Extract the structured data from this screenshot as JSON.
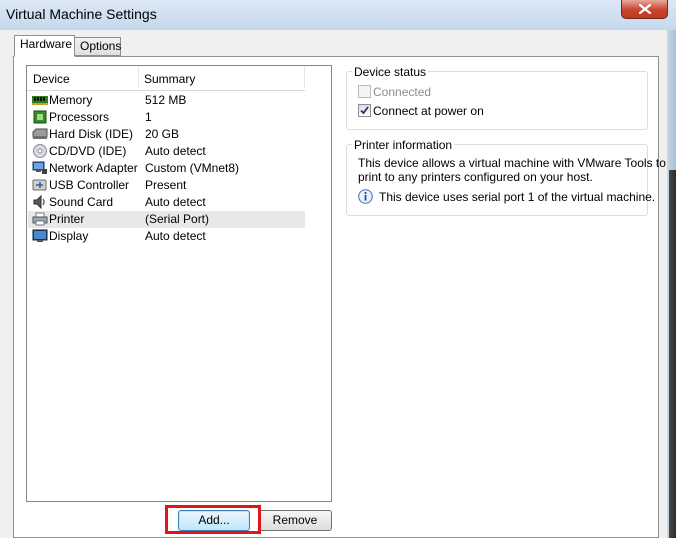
{
  "window": {
    "title": "Virtual Machine Settings"
  },
  "tabs": [
    {
      "label": "Hardware",
      "active": true
    },
    {
      "label": "Options",
      "active": false
    }
  ],
  "device_list": {
    "columns": {
      "device": "Device",
      "summary": "Summary"
    },
    "rows": [
      {
        "device": "Memory",
        "summary": "512 MB",
        "icon": "memory-icon"
      },
      {
        "device": "Processors",
        "summary": "1",
        "icon": "processor-icon"
      },
      {
        "device": "Hard Disk (IDE)",
        "summary": "20 GB",
        "icon": "hard-disk-icon"
      },
      {
        "device": "CD/DVD (IDE)",
        "summary": "Auto detect",
        "icon": "cd-dvd-icon"
      },
      {
        "device": "Network Adapter",
        "summary": "Custom (VMnet8)",
        "icon": "network-adapter-icon"
      },
      {
        "device": "USB Controller",
        "summary": "Present",
        "icon": "usb-icon"
      },
      {
        "device": "Sound Card",
        "summary": "Auto detect",
        "icon": "speaker-icon"
      },
      {
        "device": "Printer",
        "summary": "(Serial Port)",
        "icon": "printer-icon",
        "selected": true
      },
      {
        "device": "Display",
        "summary": "Auto detect",
        "icon": "display-icon"
      }
    ]
  },
  "buttons": {
    "add": "Add...",
    "remove": "Remove"
  },
  "device_status": {
    "title": "Device status",
    "connected": {
      "label": "Connected",
      "checked": false,
      "disabled": true
    },
    "connect_at_power_on": {
      "label": "Connect at power on",
      "checked": true
    }
  },
  "printer_info": {
    "title": "Printer information",
    "line1": "This device allows a virtual machine with VMware Tools to",
    "line2": "print to any printers configured on your host.",
    "note": "This device uses serial port 1 of the virtual machine.",
    "note_icon": "info-icon"
  },
  "colors": {
    "highlight": "#e0151e",
    "close_button": "#c8442d",
    "selection": "#e8e8e8"
  }
}
